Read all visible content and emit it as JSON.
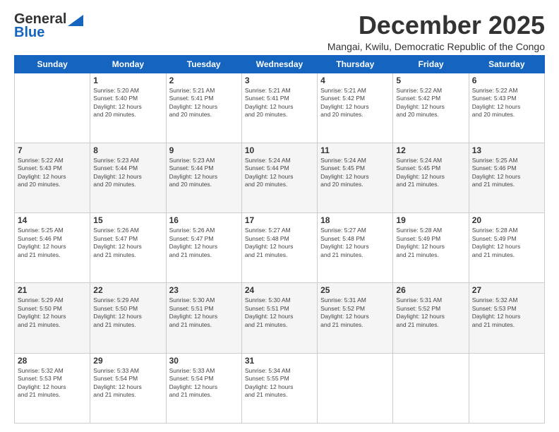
{
  "header": {
    "logo_general": "General",
    "logo_blue": "Blue",
    "month_title": "December 2025",
    "location": "Mangai, Kwilu, Democratic Republic of the Congo"
  },
  "calendar": {
    "days_of_week": [
      "Sunday",
      "Monday",
      "Tuesday",
      "Wednesday",
      "Thursday",
      "Friday",
      "Saturday"
    ],
    "weeks": [
      [
        {
          "day": "",
          "info": ""
        },
        {
          "day": "1",
          "info": "Sunrise: 5:20 AM\nSunset: 5:40 PM\nDaylight: 12 hours\nand 20 minutes."
        },
        {
          "day": "2",
          "info": "Sunrise: 5:21 AM\nSunset: 5:41 PM\nDaylight: 12 hours\nand 20 minutes."
        },
        {
          "day": "3",
          "info": "Sunrise: 5:21 AM\nSunset: 5:41 PM\nDaylight: 12 hours\nand 20 minutes."
        },
        {
          "day": "4",
          "info": "Sunrise: 5:21 AM\nSunset: 5:42 PM\nDaylight: 12 hours\nand 20 minutes."
        },
        {
          "day": "5",
          "info": "Sunrise: 5:22 AM\nSunset: 5:42 PM\nDaylight: 12 hours\nand 20 minutes."
        },
        {
          "day": "6",
          "info": "Sunrise: 5:22 AM\nSunset: 5:43 PM\nDaylight: 12 hours\nand 20 minutes."
        }
      ],
      [
        {
          "day": "7",
          "info": "Sunrise: 5:22 AM\nSunset: 5:43 PM\nDaylight: 12 hours\nand 20 minutes."
        },
        {
          "day": "8",
          "info": "Sunrise: 5:23 AM\nSunset: 5:44 PM\nDaylight: 12 hours\nand 20 minutes."
        },
        {
          "day": "9",
          "info": "Sunrise: 5:23 AM\nSunset: 5:44 PM\nDaylight: 12 hours\nand 20 minutes."
        },
        {
          "day": "10",
          "info": "Sunrise: 5:24 AM\nSunset: 5:44 PM\nDaylight: 12 hours\nand 20 minutes."
        },
        {
          "day": "11",
          "info": "Sunrise: 5:24 AM\nSunset: 5:45 PM\nDaylight: 12 hours\nand 20 minutes."
        },
        {
          "day": "12",
          "info": "Sunrise: 5:24 AM\nSunset: 5:45 PM\nDaylight: 12 hours\nand 21 minutes."
        },
        {
          "day": "13",
          "info": "Sunrise: 5:25 AM\nSunset: 5:46 PM\nDaylight: 12 hours\nand 21 minutes."
        }
      ],
      [
        {
          "day": "14",
          "info": "Sunrise: 5:25 AM\nSunset: 5:46 PM\nDaylight: 12 hours\nand 21 minutes."
        },
        {
          "day": "15",
          "info": "Sunrise: 5:26 AM\nSunset: 5:47 PM\nDaylight: 12 hours\nand 21 minutes."
        },
        {
          "day": "16",
          "info": "Sunrise: 5:26 AM\nSunset: 5:47 PM\nDaylight: 12 hours\nand 21 minutes."
        },
        {
          "day": "17",
          "info": "Sunrise: 5:27 AM\nSunset: 5:48 PM\nDaylight: 12 hours\nand 21 minutes."
        },
        {
          "day": "18",
          "info": "Sunrise: 5:27 AM\nSunset: 5:48 PM\nDaylight: 12 hours\nand 21 minutes."
        },
        {
          "day": "19",
          "info": "Sunrise: 5:28 AM\nSunset: 5:49 PM\nDaylight: 12 hours\nand 21 minutes."
        },
        {
          "day": "20",
          "info": "Sunrise: 5:28 AM\nSunset: 5:49 PM\nDaylight: 12 hours\nand 21 minutes."
        }
      ],
      [
        {
          "day": "21",
          "info": "Sunrise: 5:29 AM\nSunset: 5:50 PM\nDaylight: 12 hours\nand 21 minutes."
        },
        {
          "day": "22",
          "info": "Sunrise: 5:29 AM\nSunset: 5:50 PM\nDaylight: 12 hours\nand 21 minutes."
        },
        {
          "day": "23",
          "info": "Sunrise: 5:30 AM\nSunset: 5:51 PM\nDaylight: 12 hours\nand 21 minutes."
        },
        {
          "day": "24",
          "info": "Sunrise: 5:30 AM\nSunset: 5:51 PM\nDaylight: 12 hours\nand 21 minutes."
        },
        {
          "day": "25",
          "info": "Sunrise: 5:31 AM\nSunset: 5:52 PM\nDaylight: 12 hours\nand 21 minutes."
        },
        {
          "day": "26",
          "info": "Sunrise: 5:31 AM\nSunset: 5:52 PM\nDaylight: 12 hours\nand 21 minutes."
        },
        {
          "day": "27",
          "info": "Sunrise: 5:32 AM\nSunset: 5:53 PM\nDaylight: 12 hours\nand 21 minutes."
        }
      ],
      [
        {
          "day": "28",
          "info": "Sunrise: 5:32 AM\nSunset: 5:53 PM\nDaylight: 12 hours\nand 21 minutes."
        },
        {
          "day": "29",
          "info": "Sunrise: 5:33 AM\nSunset: 5:54 PM\nDaylight: 12 hours\nand 21 minutes."
        },
        {
          "day": "30",
          "info": "Sunrise: 5:33 AM\nSunset: 5:54 PM\nDaylight: 12 hours\nand 21 minutes."
        },
        {
          "day": "31",
          "info": "Sunrise: 5:34 AM\nSunset: 5:55 PM\nDaylight: 12 hours\nand 21 minutes."
        },
        {
          "day": "",
          "info": ""
        },
        {
          "day": "",
          "info": ""
        },
        {
          "day": "",
          "info": ""
        }
      ]
    ]
  }
}
